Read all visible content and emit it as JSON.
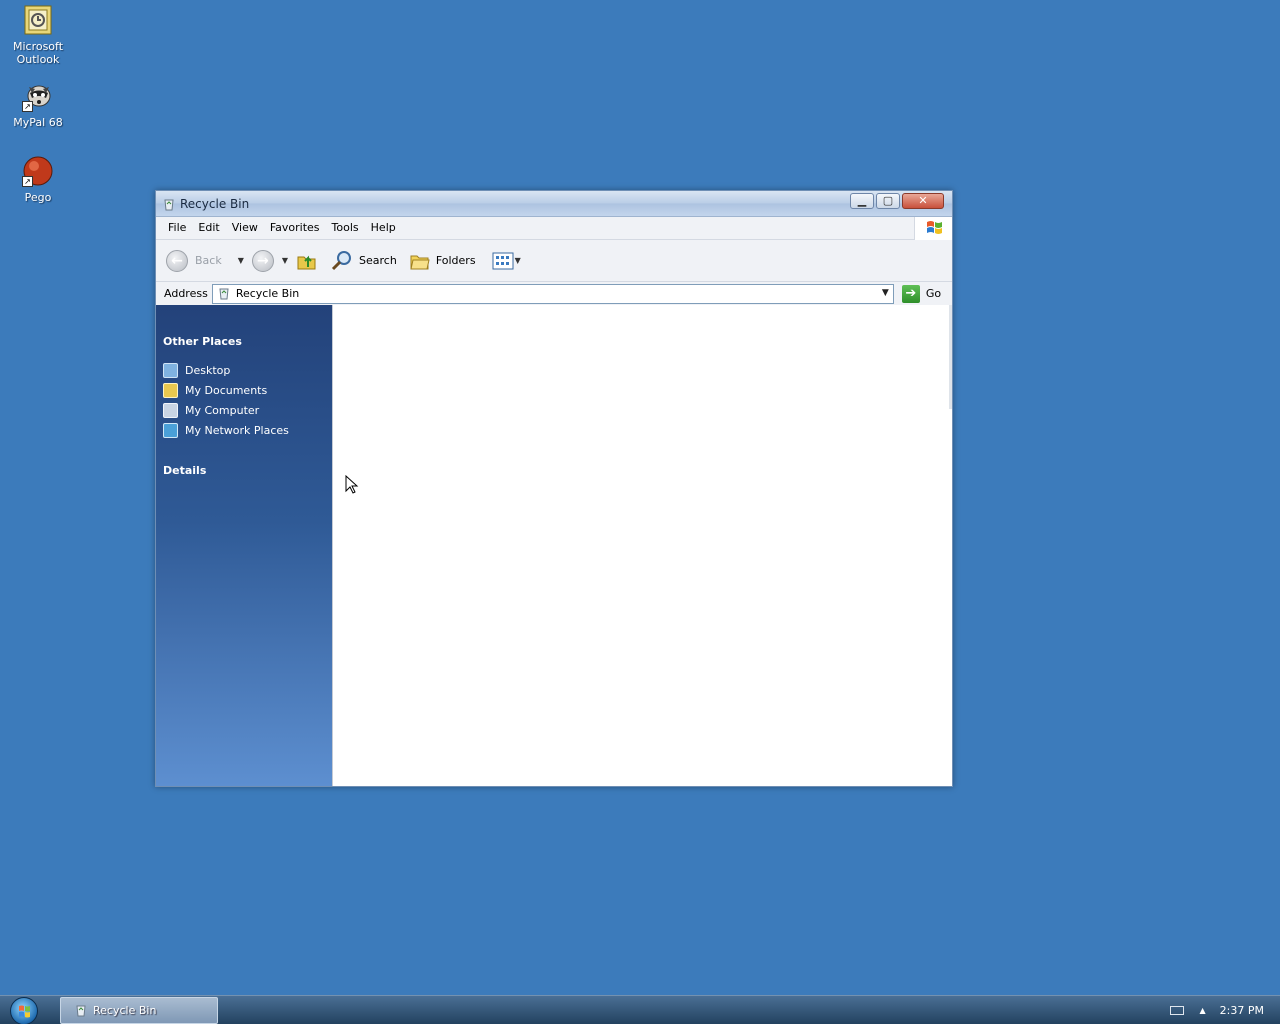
{
  "desktop": {
    "icons": [
      {
        "label_line1": "Microsoft",
        "label_line2": "Outlook"
      },
      {
        "label_line1": "MyPal 68",
        "label_line2": ""
      },
      {
        "label_line1": "Pego",
        "label_line2": ""
      }
    ]
  },
  "window": {
    "title": "Recycle Bin",
    "menu": [
      "File",
      "Edit",
      "View",
      "Favorites",
      "Tools",
      "Help"
    ],
    "toolbar": {
      "back": "Back",
      "search": "Search",
      "folders": "Folders"
    },
    "address": {
      "label": "Address",
      "value": "Recycle Bin",
      "go": "Go"
    },
    "taskpane": {
      "other_places_header": "Other Places",
      "places": [
        "Desktop",
        "My Documents",
        "My Computer",
        "My Network Places"
      ],
      "details_header": "Details"
    }
  },
  "taskbar": {
    "task_label": "Recycle Bin",
    "clock": "2:37 PM"
  },
  "colors": {
    "desktop": "#3c7bbb",
    "taskpane_top": "#23427a",
    "taskpane_bottom": "#5d8fd0"
  }
}
